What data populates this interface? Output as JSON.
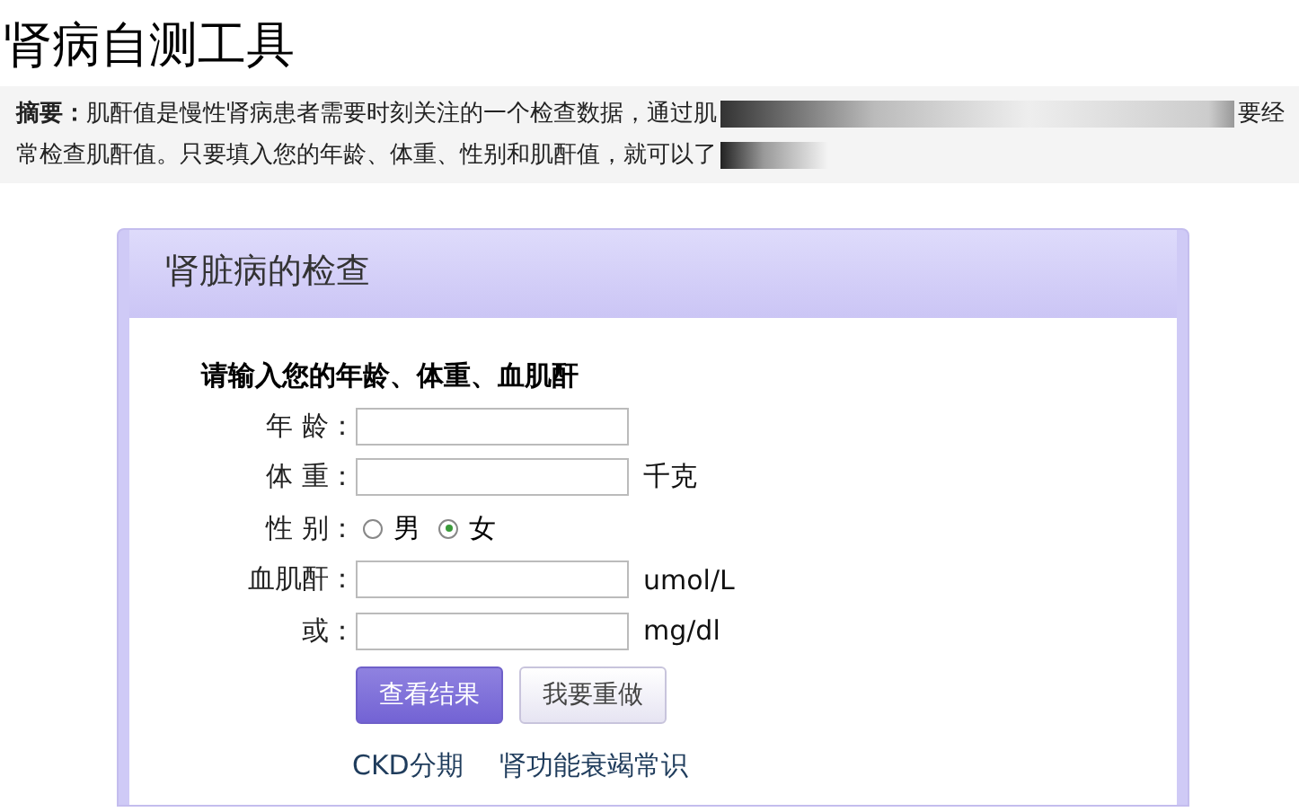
{
  "page_title": "肾病自测工具",
  "summary": [
    {
      "text": "**摘要：**肌酐值是慢性肾病患者需要时刻关注的一个检查数据，通过肌",
      "tail": "要经"
    },
    {
      "text": "常检查肌酐值。只要填入您的年龄、体重、性别和肌酐值，就可以了"
    }
  ],
  "card": {
    "title": "肾脏病的检查",
    "heading": "请输入您的年龄、体重、血肌酐",
    "rows": [
      {
        "kind": "input",
        "label": "年 龄："
      },
      {
        "kind": "input",
        "label": "体 重：",
        "unit": "千克"
      },
      {
        "kind": "radio",
        "label": "性 别：",
        "options": [
          {
            "label": "男",
            "selected": false
          },
          {
            "label": "女",
            "selected": true
          }
        ]
      },
      {
        "kind": "input",
        "label": "血肌酐：",
        "unit": "umol/L"
      },
      {
        "kind": "input",
        "label": "或：",
        "unit": "mg/dl"
      }
    ],
    "buttons": [
      {
        "label": "查看结果",
        "kind": "primary"
      },
      {
        "label": "我要重做",
        "kind": "secondary"
      }
    ],
    "links": [
      "CKD分期",
      "肾功能衰竭常识"
    ]
  }
}
